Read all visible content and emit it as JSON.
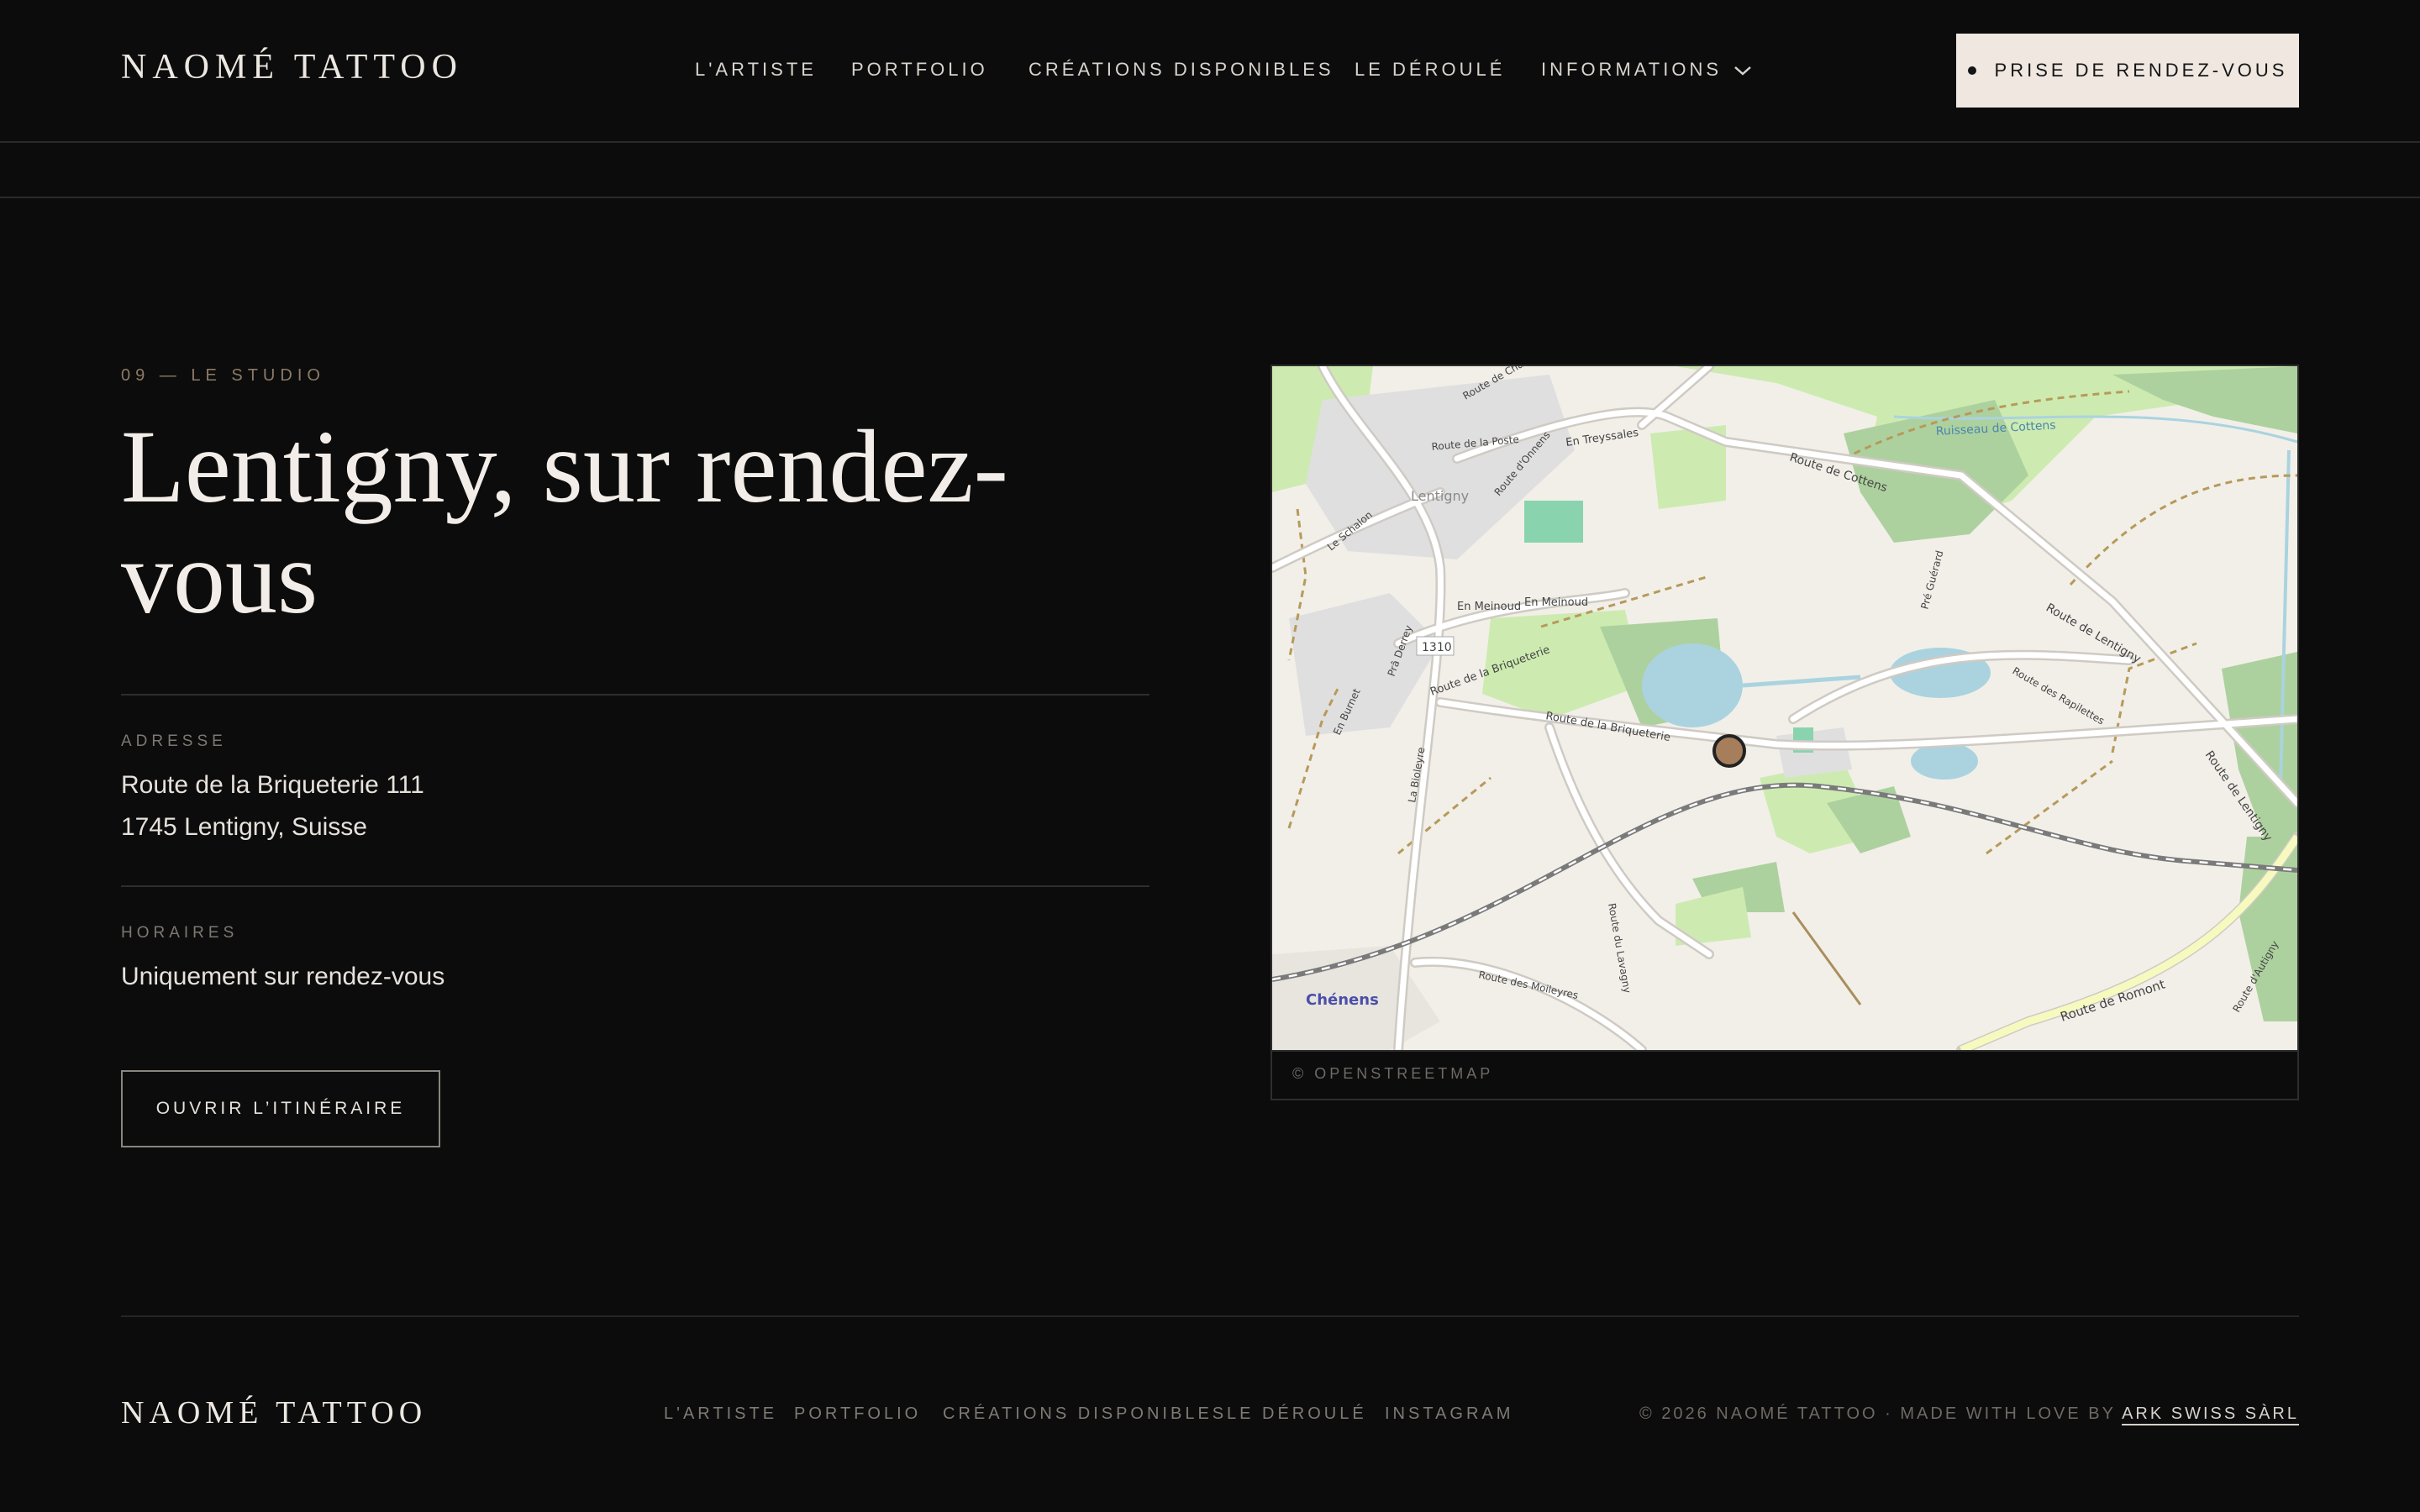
{
  "header": {
    "logo": "NAOMÉ TATTOO",
    "nav": [
      "L'ARTISTE",
      "PORTFOLIO",
      "CRÉATIONS DISPONIBLES",
      "LE DÉROULÉ",
      "INFORMATIONS"
    ],
    "cta": "PRISE DE RENDEZ-VOUS"
  },
  "section": {
    "eyebrow": "09 — LE STUDIO",
    "title": "Lentigny, sur rendez-vous",
    "address_label": "ADRESSE",
    "address_line1": "Route de la Briqueterie 111",
    "address_line2": "1745 Lentigny, Suisse",
    "hours_label": "HORAIRES",
    "hours_value": "Uniquement sur rendez-vous",
    "button": "OUVRIR L’ITINÉRAIRE"
  },
  "map": {
    "credit": "© OPENSTREETMAP",
    "labels": {
      "village": "Lentigny",
      "station": "Chénens",
      "road_number": "1310",
      "cottens": "Route de Cottens",
      "lentigny": "Route de Lentigny",
      "lentigny2": "Route de Lentigny",
      "briqueterie": "Route de la Briqueterie",
      "briqueterie2": "Route de la Briqueterie",
      "romont": "Route de Romont",
      "meinoud": "En Meinoud",
      "meinoud2": "En Meinoud",
      "treyssales": "En Treyssales",
      "ruisseau": "Ruisseau de Cottens",
      "rapilettes": "Route des Rapilettes",
      "moileyres": "Route des Moileyres",
      "posse": "Route de la Poste",
      "onnens": "Route d'Onnens",
      "derrey": "Prâ Derrey",
      "burnet": "En Burnet",
      "bioleyres": "La Bioleyre",
      "autigny": "Route d'Autigny",
      "chattes": "Route de Cha",
      "schalens": "Le Schalon",
      "guerard": "Pré Guérard",
      "lavagny": "Route du Lavagny"
    },
    "colors": {
      "marker": "#a77e5c",
      "forest": "#add19e",
      "water": "#aad3df",
      "rail": "#7a7a7a"
    }
  },
  "footer": {
    "logo": "NAOMÉ TATTOO",
    "nav": [
      "L'ARTISTE",
      "PORTFOLIO",
      "CRÉATIONS DISPONIBLES",
      "LE DÉROULÉ",
      "INSTAGRAM"
    ],
    "copyright": "© 2026 NAOMÉ TATTOO · MADE WITH LOVE BY",
    "credit_link": "ARK SWISS SÀRL"
  }
}
